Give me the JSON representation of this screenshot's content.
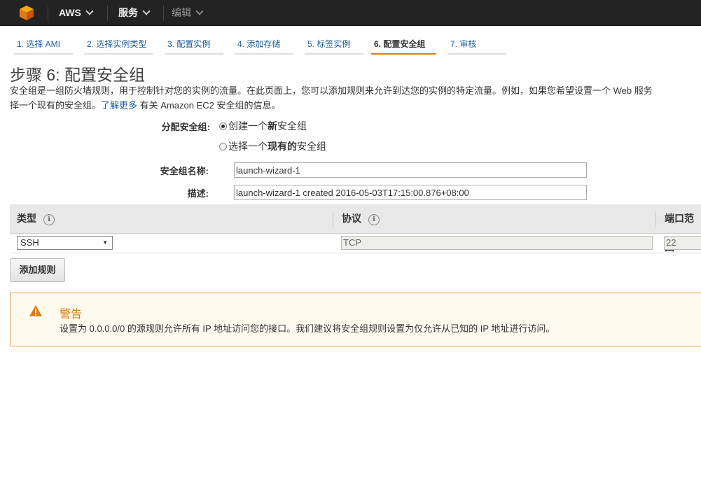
{
  "nav": {
    "brand": "AWS",
    "services": "服务",
    "edit": "编辑"
  },
  "steps": [
    {
      "label": "1. 选择 AMI"
    },
    {
      "label": "2. 选择实例类型"
    },
    {
      "label": "3. 配置实例"
    },
    {
      "label": "4. 添加存储"
    },
    {
      "label": "5. 标签实例"
    },
    {
      "label": "6. 配置安全组",
      "active": true
    },
    {
      "label": "7. 审核"
    }
  ],
  "page": {
    "title": "步骤 6: 配置安全组",
    "intro_line1": "安全组是一组防火墙规则，用于控制针对您的实例的流量。在此页面上，您可以添加规则来允许到达您的实例的特定流量。例如，如果您希望设置一个 Web 服务",
    "intro_line2_a": "择一个现有的安全组。",
    "learn_more": "了解更多",
    "intro_line2_b": " 有关 Amazon EC2 安全组的信息。"
  },
  "form": {
    "assign_label": "分配安全组:",
    "radio_create_a": "创建一个",
    "radio_create_b": "新",
    "radio_create_c": "安全组",
    "radio_select_a": "选择一个",
    "radio_select_b": "现有的",
    "radio_select_c": "安全组",
    "selected": "create",
    "name_label": "安全组名称:",
    "name_value": "launch-wizard-1",
    "desc_label": "描述:",
    "desc_value": "launch-wizard-1 created 2016-05-03T17:15:00.876+08:00"
  },
  "rules_table": {
    "headers": [
      "类型",
      "协议",
      "端口范围"
    ],
    "info_icon": "i",
    "rows": [
      {
        "type": "SSH",
        "protocol": "TCP",
        "port": "22"
      }
    ]
  },
  "add_rule_button": "添加规则",
  "warning": {
    "title": "警告",
    "text": "设置为 0.0.0.0/0 的源规则允许所有 IP 地址访问您的接口。我们建议将安全组规则设置为仅允许从已知的 IP 地址进行访问。",
    "color": "#d27c0c"
  },
  "colors": {
    "accent": "#e47911",
    "link": "#1f5c98",
    "nav_bg": "#232323"
  }
}
